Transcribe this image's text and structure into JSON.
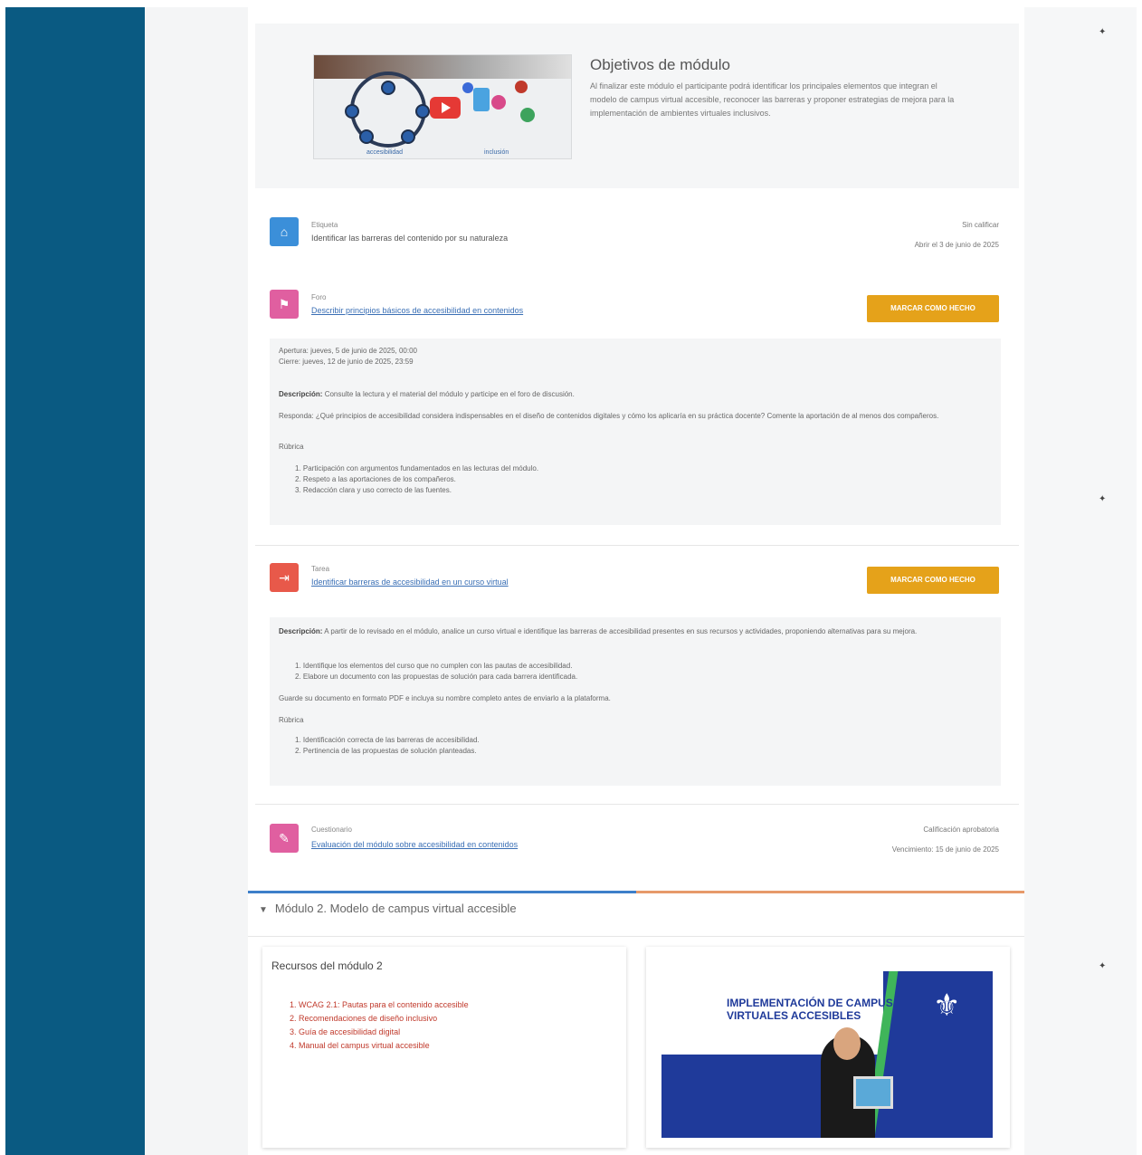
{
  "header": {
    "title": "Objetivos de módulo",
    "text": "Al finalizar este módulo el participante podrá identificar los principales elementos que integran el modelo de campus virtual accesible, reconocer las barreras y proponer estrategias de mejora para la implementación de ambientes virtuales inclusivos.",
    "video_caption_left": "accesibilidad",
    "video_caption_right": "inclusión"
  },
  "activities": [
    {
      "type": "Etiqueta",
      "title": "Identificar las barreras del contenido por su naturaleza",
      "meta1": "Sin calificar",
      "meta2": "Abrir el 3 de junio de 2025"
    },
    {
      "type": "Foro",
      "title": "Describir principios básicos de accesibilidad en contenidos",
      "button": "MARCAR COMO HECHO",
      "desc_line1": "Apertura: jueves, 5 de junio de 2025, 00:00",
      "desc_line2": "Cierre: jueves, 12 de junio de 2025, 23:59",
      "desc_label": "Descripción:",
      "desc_main": "Consulte la lectura y el material del módulo y participe en el foro de discusión.",
      "desc_body": "Responda: ¿Qué principios de accesibilidad considera indispensables en el diseño de contenidos digitales y cómo los aplicaría en su práctica docente? Comente la aportación de al menos dos compañeros.",
      "rub_label": "Rúbrica",
      "rub_items": [
        "1. Participación con argumentos fundamentados en las lecturas del módulo.",
        "2. Respeto a las aportaciones de los compañeros.",
        "3. Redacción clara y uso correcto de las fuentes."
      ]
    },
    {
      "type": "Tarea",
      "title": "Identificar barreras de accesibilidad en un curso virtual",
      "button": "MARCAR COMO HECHO",
      "desc_label": "Descripción:",
      "desc_main": "A partir de lo revisado en el módulo, analice un curso virtual e identifique las barreras de accesibilidad presentes en sus recursos y actividades, proponiendo alternativas para su mejora.",
      "steps": [
        "1. Identifique los elementos del curso que no cumplen con las pautas de accesibilidad.",
        "2. Elabore un documento con las propuestas de solución para cada barrera identificada."
      ],
      "note": "Guarde su documento en formato PDF e incluya su nombre completo antes de enviarlo a la plataforma.",
      "rub_label": "Rúbrica",
      "rub_items": [
        "1. Identificación correcta de las barreras de accesibilidad.",
        "2. Pertinencia de las propuestas de solución planteadas."
      ]
    },
    {
      "type": "Cuestionario",
      "title": "Evaluación del módulo sobre accesibilidad en contenidos",
      "meta1": "Calificación aprobatoria",
      "meta2": "Vencimiento: 15 de junio de 2025"
    }
  ],
  "module2": {
    "heading": "Módulo 2. Modelo de campus virtual accesible",
    "card_title": "Recursos del módulo 2",
    "resources": [
      "1. WCAG 2.1: Pautas para el contenido accesible",
      "2. Recomendaciones de diseño inclusivo",
      "3. Guía de accesibilidad digital",
      "4. Manual del campus virtual accesible"
    ],
    "banner_title_line1": "IMPLEMENTACIÓN DE CAMPUS",
    "banner_title_line2": "VIRTUALES ACCESIBLES"
  },
  "colors": {
    "sidebar": "#0a5a82",
    "done_button": "#e5a21a",
    "link": "#3a6fb5",
    "etiqueta_icon": "#3b8fd9",
    "foro_icon": "#e05fa0",
    "tarea_icon": "#e8594a",
    "cuestionario_icon": "#e05fa0"
  },
  "icons": [
    "star-icon",
    "label-icon",
    "forum-icon",
    "assignment-icon",
    "quiz-icon",
    "chevron-down-icon",
    "play-icon"
  ]
}
